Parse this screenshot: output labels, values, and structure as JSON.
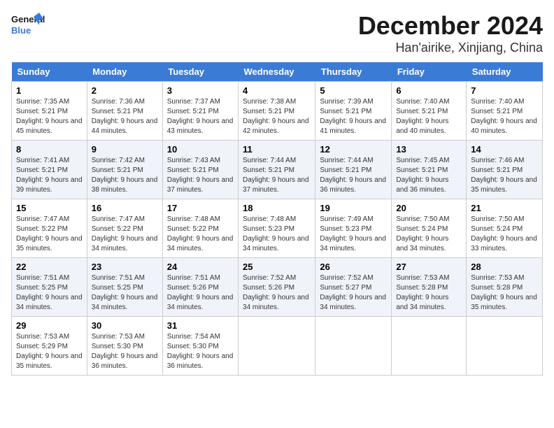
{
  "logo": {
    "line1": "General",
    "line2": "Blue"
  },
  "title": "December 2024",
  "location": "Han'airike, Xinjiang, China",
  "weekdays": [
    "Sunday",
    "Monday",
    "Tuesday",
    "Wednesday",
    "Thursday",
    "Friday",
    "Saturday"
  ],
  "weeks": [
    [
      {
        "day": "1",
        "sunrise": "7:35 AM",
        "sunset": "5:21 PM",
        "daylight": "9 hours and 45 minutes."
      },
      {
        "day": "2",
        "sunrise": "7:36 AM",
        "sunset": "5:21 PM",
        "daylight": "9 hours and 44 minutes."
      },
      {
        "day": "3",
        "sunrise": "7:37 AM",
        "sunset": "5:21 PM",
        "daylight": "9 hours and 43 minutes."
      },
      {
        "day": "4",
        "sunrise": "7:38 AM",
        "sunset": "5:21 PM",
        "daylight": "9 hours and 42 minutes."
      },
      {
        "day": "5",
        "sunrise": "7:39 AM",
        "sunset": "5:21 PM",
        "daylight": "9 hours and 41 minutes."
      },
      {
        "day": "6",
        "sunrise": "7:40 AM",
        "sunset": "5:21 PM",
        "daylight": "9 hours and 40 minutes."
      },
      {
        "day": "7",
        "sunrise": "7:40 AM",
        "sunset": "5:21 PM",
        "daylight": "9 hours and 40 minutes."
      }
    ],
    [
      {
        "day": "8",
        "sunrise": "7:41 AM",
        "sunset": "5:21 PM",
        "daylight": "9 hours and 39 minutes."
      },
      {
        "day": "9",
        "sunrise": "7:42 AM",
        "sunset": "5:21 PM",
        "daylight": "9 hours and 38 minutes."
      },
      {
        "day": "10",
        "sunrise": "7:43 AM",
        "sunset": "5:21 PM",
        "daylight": "9 hours and 37 minutes."
      },
      {
        "day": "11",
        "sunrise": "7:44 AM",
        "sunset": "5:21 PM",
        "daylight": "9 hours and 37 minutes."
      },
      {
        "day": "12",
        "sunrise": "7:44 AM",
        "sunset": "5:21 PM",
        "daylight": "9 hours and 36 minutes."
      },
      {
        "day": "13",
        "sunrise": "7:45 AM",
        "sunset": "5:21 PM",
        "daylight": "9 hours and 36 minutes."
      },
      {
        "day": "14",
        "sunrise": "7:46 AM",
        "sunset": "5:21 PM",
        "daylight": "9 hours and 35 minutes."
      }
    ],
    [
      {
        "day": "15",
        "sunrise": "7:47 AM",
        "sunset": "5:22 PM",
        "daylight": "9 hours and 35 minutes."
      },
      {
        "day": "16",
        "sunrise": "7:47 AM",
        "sunset": "5:22 PM",
        "daylight": "9 hours and 34 minutes."
      },
      {
        "day": "17",
        "sunrise": "7:48 AM",
        "sunset": "5:22 PM",
        "daylight": "9 hours and 34 minutes."
      },
      {
        "day": "18",
        "sunrise": "7:48 AM",
        "sunset": "5:23 PM",
        "daylight": "9 hours and 34 minutes."
      },
      {
        "day": "19",
        "sunrise": "7:49 AM",
        "sunset": "5:23 PM",
        "daylight": "9 hours and 34 minutes."
      },
      {
        "day": "20",
        "sunrise": "7:50 AM",
        "sunset": "5:24 PM",
        "daylight": "9 hours and 34 minutes."
      },
      {
        "day": "21",
        "sunrise": "7:50 AM",
        "sunset": "5:24 PM",
        "daylight": "9 hours and 33 minutes."
      }
    ],
    [
      {
        "day": "22",
        "sunrise": "7:51 AM",
        "sunset": "5:25 PM",
        "daylight": "9 hours and 34 minutes."
      },
      {
        "day": "23",
        "sunrise": "7:51 AM",
        "sunset": "5:25 PM",
        "daylight": "9 hours and 34 minutes."
      },
      {
        "day": "24",
        "sunrise": "7:51 AM",
        "sunset": "5:26 PM",
        "daylight": "9 hours and 34 minutes."
      },
      {
        "day": "25",
        "sunrise": "7:52 AM",
        "sunset": "5:26 PM",
        "daylight": "9 hours and 34 minutes."
      },
      {
        "day": "26",
        "sunrise": "7:52 AM",
        "sunset": "5:27 PM",
        "daylight": "9 hours and 34 minutes."
      },
      {
        "day": "27",
        "sunrise": "7:53 AM",
        "sunset": "5:28 PM",
        "daylight": "9 hours and 34 minutes."
      },
      {
        "day": "28",
        "sunrise": "7:53 AM",
        "sunset": "5:28 PM",
        "daylight": "9 hours and 35 minutes."
      }
    ],
    [
      {
        "day": "29",
        "sunrise": "7:53 AM",
        "sunset": "5:29 PM",
        "daylight": "9 hours and 35 minutes."
      },
      {
        "day": "30",
        "sunrise": "7:53 AM",
        "sunset": "5:30 PM",
        "daylight": "9 hours and 36 minutes."
      },
      {
        "day": "31",
        "sunrise": "7:54 AM",
        "sunset": "5:30 PM",
        "daylight": "9 hours and 36 minutes."
      },
      null,
      null,
      null,
      null
    ]
  ]
}
